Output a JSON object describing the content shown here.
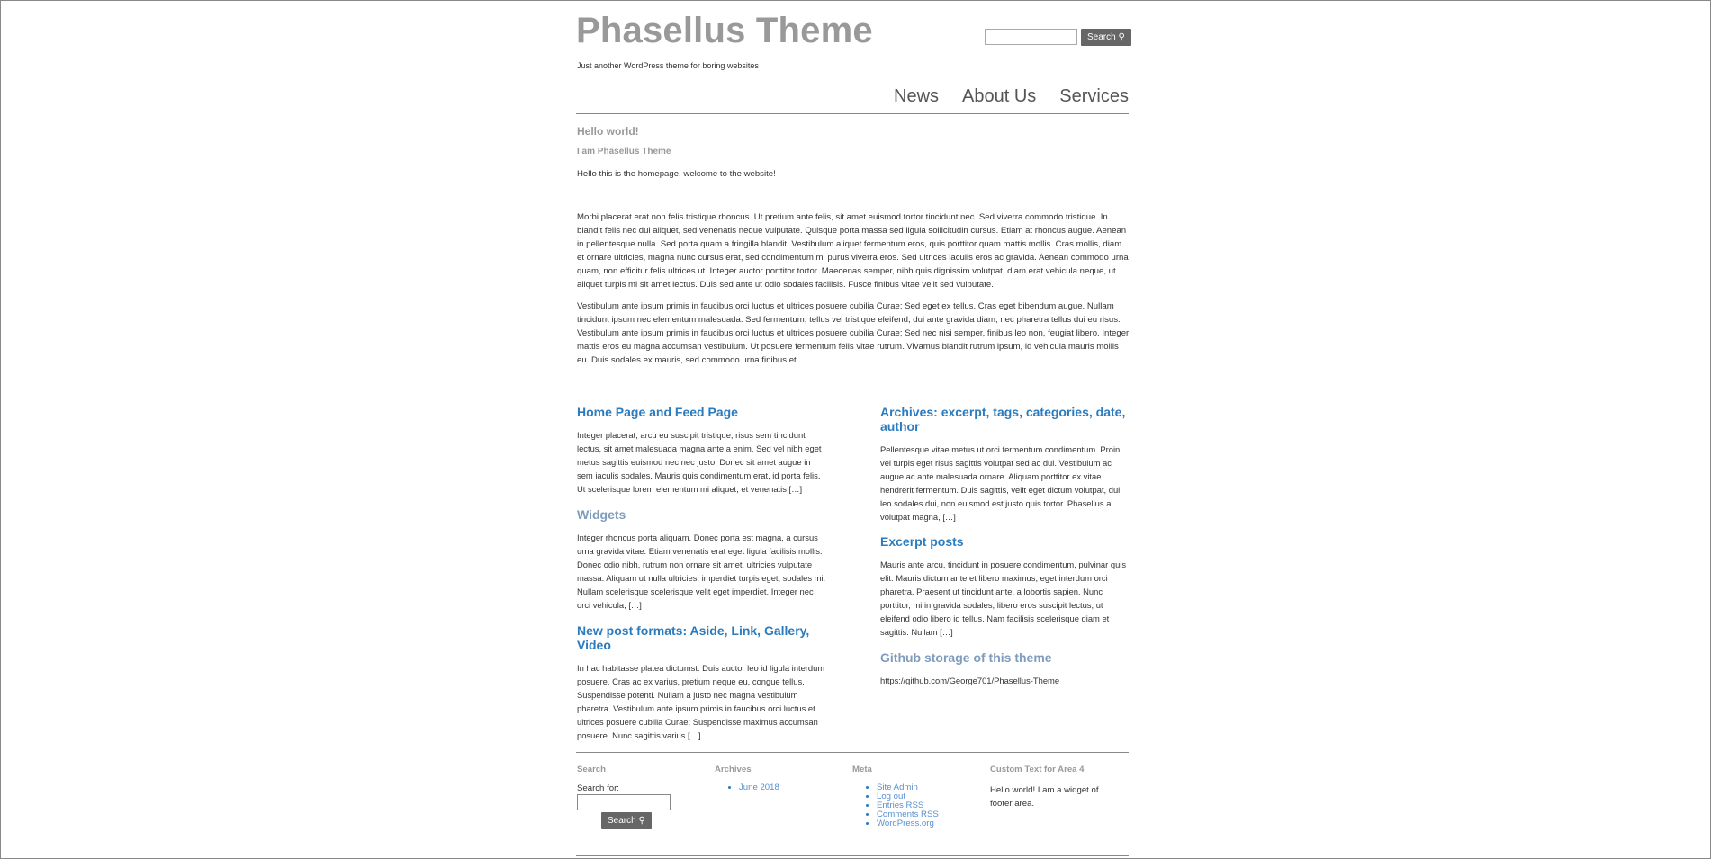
{
  "header": {
    "site_title": "Phasellus Theme",
    "tagline": "Just another WordPress theme for boring websites",
    "search_placeholder": "",
    "search_button": "Search ⚲"
  },
  "nav": [
    {
      "label": "News"
    },
    {
      "label": "About Us"
    },
    {
      "label": "Services"
    }
  ],
  "post": {
    "title": "Hello world!",
    "subtitle": "I am Phasellus Theme",
    "intro": "Hello this is the homepage, welcome to the website!",
    "para1": "Morbi placerat erat non felis tristique rhoncus. Ut pretium ante felis, sit amet euismod tortor tincidunt nec. Sed viverra commodo tristique. In blandit felis nec dui aliquet, sed venenatis neque vulputate. Quisque porta massa sed ligula sollicitudin cursus. Etiam at rhoncus augue. Aenean in pellentesque nulla. Sed porta quam a fringilla blandit. Vestibulum aliquet fermentum eros, quis porttitor quam mattis mollis. Cras mollis, diam et ornare ultricies, magna nunc cursus erat, sed condimentum mi purus viverra eros. Sed ultrices iaculis eros ac gravida. Aenean commodo urna quam, non efficitur felis ultrices ut. Integer auctor porttitor tortor. Maecenas semper, nibh quis dignissim volutpat, diam erat vehicula neque, ut aliquet turpis mi sit amet lectus. Duis sed ante ut odio sodales facilisis. Fusce finibus vitae velit sed vulputate.",
    "para2": "Vestibulum ante ipsum primis in faucibus orci luctus et ultrices posuere cubilia Curae; Sed eget ex tellus. Cras eget bibendum augue. Nullam tincidunt ipsum nec elementum malesuada. Sed fermentum, tellus vel tristique eleifend, dui ante gravida diam, nec pharetra tellus dui eu risus. Vestibulum ante ipsum primis in faucibus orci luctus et ultrices posuere cubilia Curae; Sed nec nisi semper, finibus leo non, feugiat libero. Integer mattis eros eu magna accumsan vestibulum. Ut posuere fermentum felis vitae rutrum. Vivamus blandit rutrum ipsum, id vehicula mauris mollis eu. Duis sodales ex mauris, sed commodo urna finibus et."
  },
  "left_posts": [
    {
      "title": "Home Page and Feed Page",
      "excerpt": "Integer placerat, arcu eu suscipit tristique, risus sem tincidunt lectus, sit amet malesuada magna ante a enim. Sed vel nibh eget metus sagittis euismod nec nec justo. Donec sit amet augue in sem iaculis sodales. Mauris quis condimentum erat, id porta felis. Ut scelerisque lorem elementum mi aliquet, et venenatis […]"
    },
    {
      "title": "Widgets",
      "excerpt": "Integer rhoncus porta aliquam. Donec porta est magna, a cursus urna gravida vitae. Etiam venenatis erat eget ligula facilisis mollis. Donec odio nibh, rutrum non ornare sit amet, ultricies vulputate massa. Aliquam ut nulla ultricies, imperdiet turpis eget, sodales mi. Nullam scelerisque scelerisque velit eget imperdiet. Integer nec orci vehicula, […]"
    },
    {
      "title": "New post formats: Aside, Link, Gallery, Video",
      "excerpt": "In hac habitasse platea dictumst. Duis auctor leo id ligula interdum posuere. Cras ac ex varius, pretium neque eu, congue tellus. Suspendisse potenti. Nullam a justo nec magna vestibulum pharetra. Vestibulum ante ipsum primis in faucibus orci luctus et ultrices posuere cubilia Curae; Suspendisse maximus accumsan posuere. Nunc sagittis varius […]"
    }
  ],
  "right_posts": [
    {
      "title": "Archives: excerpt, tags, categories, date, author",
      "excerpt": "Pellentesque vitae metus ut orci fermentum condimentum. Proin vel turpis eget risus sagittis volutpat sed ac dui. Vestibulum ac augue ac ante malesuada ornare. Aliquam porttitor ex vitae hendrerit fermentum. Duis sagittis, velit eget dictum volutpat, dui leo sodales dui, non euismod est justo quis tortor. Phasellus a volutpat magna, […]"
    },
    {
      "title": "Excerpt posts",
      "excerpt": "Mauris ante arcu, tincidunt in posuere condimentum, pulvinar quis elit. Mauris dictum ante et libero maximus, eget interdum orci pharetra. Praesent ut tincidunt ante, a lobortis sapien. Nunc porttitor, mi in gravida sodales, libero eros suscipit lectus, ut eleifend odio libero id tellus. Nam facilisis scelerisque diam et sagittis. Nullam […]"
    },
    {
      "title": "Github storage of this theme",
      "excerpt": "https://github.com/George701/Phasellus-Theme"
    }
  ],
  "footer": {
    "search_label": "Search",
    "search_for": "Search for:",
    "search_button": "Search ⚲",
    "archives_label": "Archives",
    "archives": [
      "June 2018"
    ],
    "meta_label": "Meta",
    "meta": [
      "Site Admin",
      "Log out",
      "Entries RSS",
      "Comments RSS",
      "WordPress.org"
    ],
    "custom_label": "Custom Text for Area 4",
    "custom_text": "Hello world! I am a widget of footer area."
  },
  "colors": {
    "link": "#2b7bbf",
    "muted_link": "#7f9cbd",
    "title": "#999999"
  }
}
